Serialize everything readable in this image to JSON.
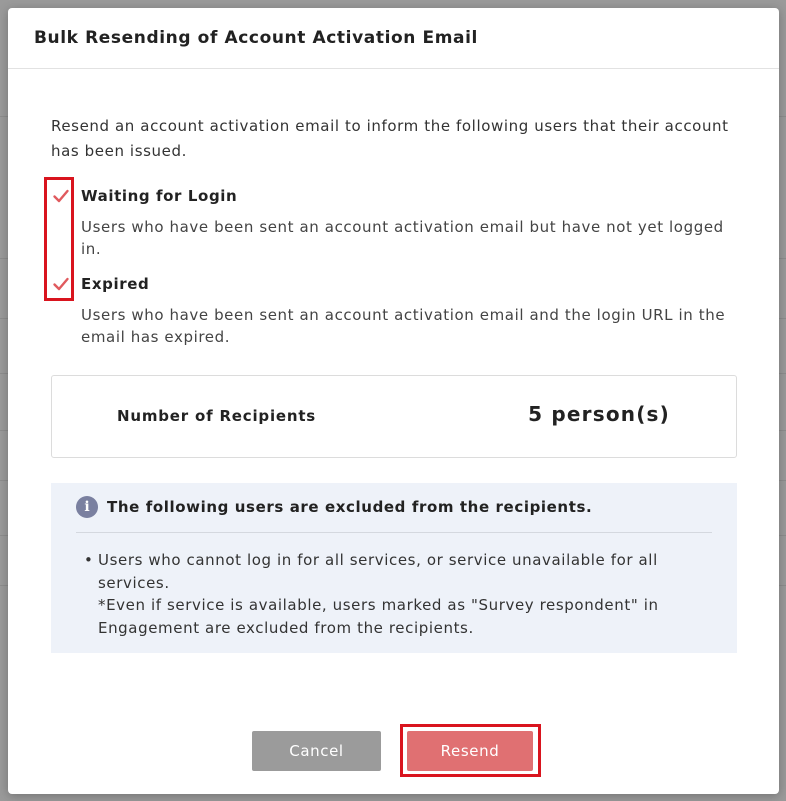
{
  "modal": {
    "title": "Bulk Resending of Account Activation Email",
    "intro": "Resend an account activation email to inform the following users that their account has been issued.",
    "options": [
      {
        "label": "Waiting for Login",
        "checked": true,
        "description": "Users who have been sent an account activation email but have not yet logged in."
      },
      {
        "label": "Expired",
        "checked": true,
        "description": "Users who have been sent an account activation email and the login URL in the email has expired."
      }
    ],
    "recipients": {
      "label": "Number of Recipients",
      "value": "5 person(s)"
    },
    "excluded": {
      "icon": "info-icon",
      "title": "The following users are excluded from the recipients.",
      "bullet": "•",
      "lines": [
        "Users who cannot log in for all services, or service unavailable for all services.",
        "*Even if service is available, users marked as \"Survey respondent\" in Engagement are excluded from the recipients."
      ]
    },
    "buttons": {
      "cancel": "Cancel",
      "resend": "Resend"
    }
  },
  "colors": {
    "check_mark": "#e05a5e",
    "resend_button": "#e07072",
    "cancel_button": "#9b9b9b",
    "highlight_border": "#d9141e",
    "excluded_bg": "#eef2f9"
  }
}
